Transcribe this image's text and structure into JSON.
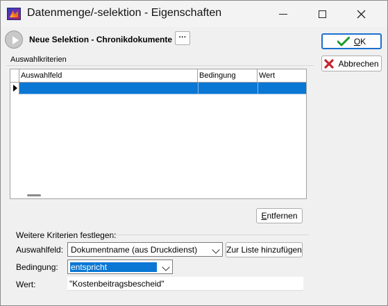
{
  "window": {
    "title": "Datenmenge/-selektion - Eigenschaften",
    "controls": {
      "minimize": "minimize-icon",
      "maximize": "maximize-icon",
      "close": "close-icon"
    }
  },
  "header": {
    "selection_title": "Neue Selektion - Chronikdokumente",
    "more_button": "···"
  },
  "actions": {
    "ok_label": "OK",
    "cancel_label": "Abbrechen"
  },
  "criteria_group": {
    "label": "Auswahlkriterien",
    "columns": [
      "Auswahlfeld",
      "Bedingung",
      "Wert"
    ],
    "rows": [
      {
        "field": "",
        "condition": "",
        "value": ""
      }
    ],
    "remove_label": "Entfernen"
  },
  "more_criteria": {
    "label": "Weitere Kriterien festlegen:",
    "field_label": "Auswahlfeld:",
    "field_value": "Dokumentname (aus Druckdienst)",
    "add_label": "Zur Liste hinzufügen",
    "condition_label": "Bedingung:",
    "condition_value": "entspricht",
    "value_label": "Wert:",
    "value_value": "\"Kostenbeitragsbescheid\""
  },
  "colors": {
    "selection": "#0a77d4",
    "ok_border": "#1b6fd0",
    "check_icon": "#1f9a2c",
    "cancel_icon": "#c4262e"
  }
}
